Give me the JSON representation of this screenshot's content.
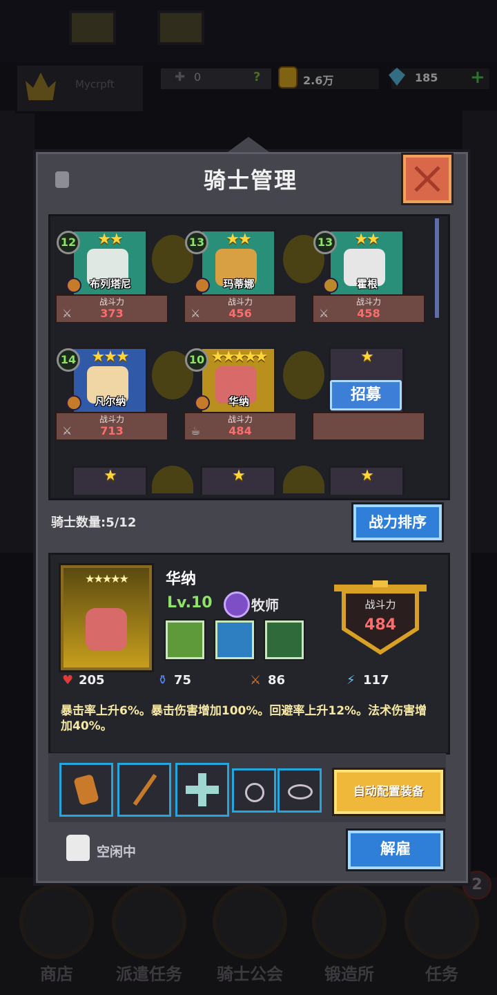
{
  "top_bar": {
    "player_name": "Mycrpft",
    "fame_value": "0",
    "fame_help": "?",
    "gold_value": "2.6万",
    "gem_value": "185",
    "gem_add": "+"
  },
  "bottom_nav": {
    "items": [
      {
        "label": "商店",
        "icon": "shop-icon"
      },
      {
        "label": "派遣任务",
        "icon": "dispatch-icon"
      },
      {
        "label": "骑士公会",
        "icon": "guild-icon"
      },
      {
        "label": "锻造所",
        "icon": "forge-icon"
      },
      {
        "label": "任务",
        "icon": "quest-icon"
      }
    ],
    "quest_badge": "2"
  },
  "panel": {
    "title": "骑士管理",
    "close_icon": "close-icon"
  },
  "knights": [
    {
      "level": "12",
      "stars": "★★",
      "name": "布列塔尼",
      "power_label": "战斗力",
      "power": "373",
      "color": "#2a8f78"
    },
    {
      "level": "13",
      "stars": "★★",
      "name": "玛蒂娜",
      "power_label": "战斗力",
      "power": "456",
      "color": "#2a8f78"
    },
    {
      "level": "13",
      "stars": "★★",
      "name": "霍根",
      "power_label": "战斗力",
      "power": "458",
      "color": "#2a8f78"
    },
    {
      "level": "14",
      "stars": "★★★",
      "name": "凡尔纳",
      "power_label": "战斗力",
      "power": "713",
      "color": "#3059a8"
    },
    {
      "level": "10",
      "stars": "★★★★★",
      "name": "华纳",
      "power_label": "战斗力",
      "power": "484",
      "color": "#b98f1e"
    }
  ],
  "empty_slots": [
    {
      "stars": "★",
      "recruit_label": "招募"
    },
    {
      "stars": "★"
    },
    {
      "stars": "★"
    },
    {
      "stars": "★"
    }
  ],
  "roster": {
    "count_label": "骑士数量:5/12",
    "sort_button": "战力排序"
  },
  "detail": {
    "portrait_stars": "★★★★★",
    "name": "华纳",
    "level": "Lv.10",
    "class_name": "牧师",
    "power_label": "战斗力",
    "power": "484",
    "stats": {
      "hp": "205",
      "mana": "75",
      "attack": "86",
      "speed": "117"
    },
    "description": "暴击率上升6%。暴击伤害增加100%。回避率上升12%。法术伤害增加40%。"
  },
  "equipment": {
    "auto_button": "自动配置装备",
    "slots": [
      "gauntlet-icon",
      "staff-icon",
      "cross-icon",
      "ring-icon",
      "bracelet-icon"
    ]
  },
  "status": {
    "idle_text": "空闲中",
    "dismiss_button": "解雇"
  },
  "colors": {
    "power_red": "#ff6c6c",
    "level_green": "#8fe36b",
    "star_gold": "#ffd53a",
    "button_blue": "#2f7fd8",
    "button_gold": "#f0b83a"
  }
}
